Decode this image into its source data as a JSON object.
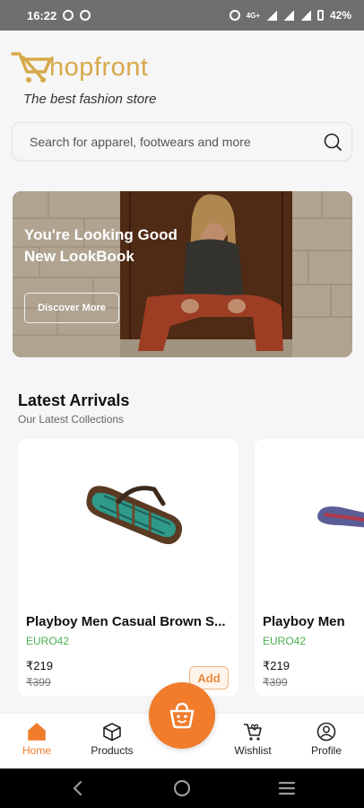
{
  "status_bar": {
    "time": "16:22",
    "network": "4G+",
    "battery": "42%"
  },
  "brand": {
    "name": "hopfront",
    "tagline": "The best fashion store"
  },
  "search": {
    "placeholder": "Search for apparel, footwears and more"
  },
  "banner": {
    "title": "You're Looking Good New LookBook",
    "button": "Discover More"
  },
  "section": {
    "title": "Latest Arrivals",
    "subtitle": "Our Latest Collections"
  },
  "products": [
    {
      "name": "Playboy Men Casual Brown S...",
      "code": "EURO42",
      "price": "₹219",
      "mrp": "₹399",
      "add_label": "Add"
    },
    {
      "name": "Playboy Men",
      "code": "EURO42",
      "price": "₹219",
      "mrp": "₹399"
    }
  ],
  "bottom_nav": {
    "items": [
      "Home",
      "Products",
      "Wishlist",
      "Profile"
    ],
    "active": "Home"
  },
  "colors": {
    "accent": "#f07c2c",
    "brand": "#d8a94b",
    "code": "#4caf50"
  }
}
